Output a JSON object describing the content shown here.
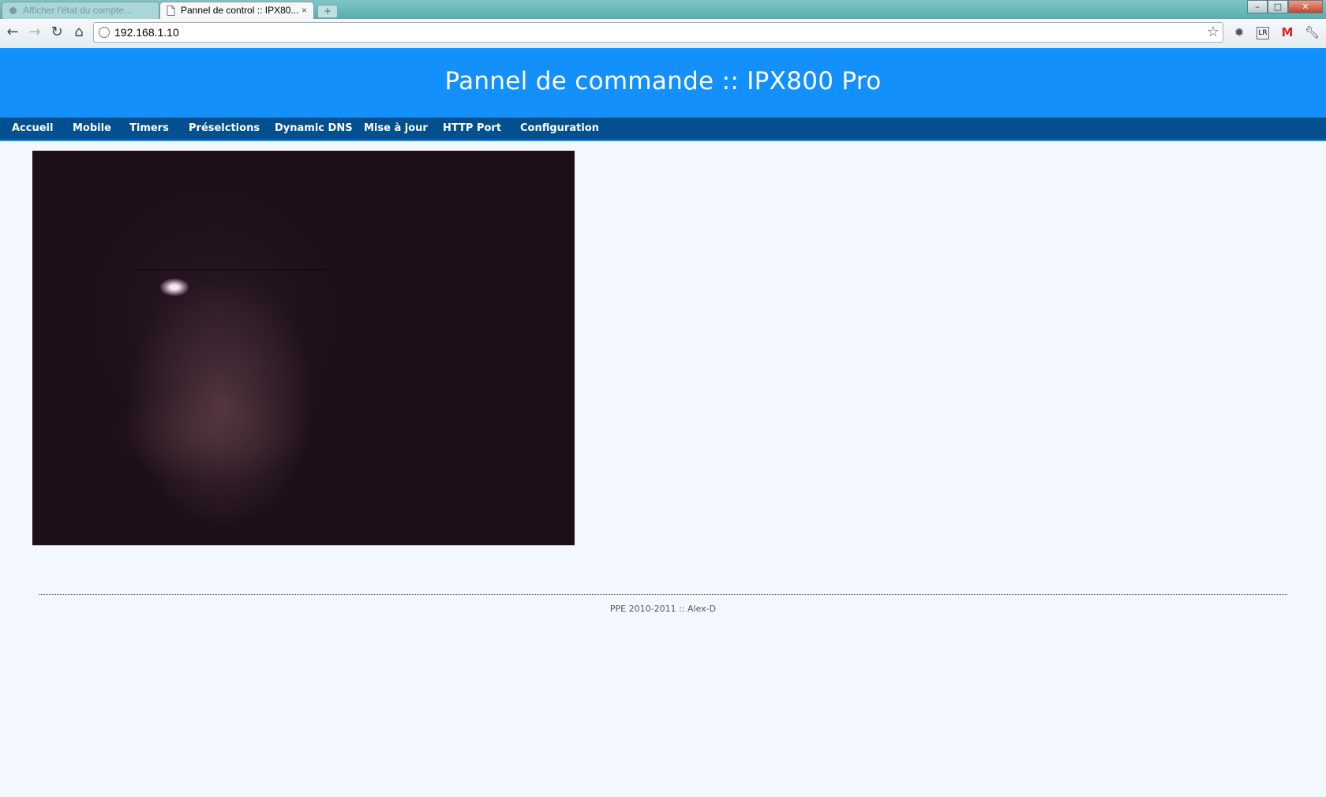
{
  "browser": {
    "tabs": [
      {
        "title": "Afficher l'état du compte..."
      },
      {
        "title": "Pannel de control :: IPX80..."
      }
    ],
    "new_tab_label": "+",
    "url": "192.168.1.10",
    "window_buttons": {
      "minimize": "–",
      "maximize": "□",
      "close": "✕"
    },
    "extensions": [
      "gear-extension-icon",
      "lr-extension-icon",
      "gmail-icon",
      "wrench-icon"
    ]
  },
  "header": {
    "title": "Pannel de commande :: IPX800 Pro",
    "color": "#1390fb"
  },
  "menu": {
    "color": "#02508f",
    "items": [
      {
        "label": "Accueil"
      },
      {
        "label": "Mobile"
      },
      {
        "label": "Timers"
      },
      {
        "label": "Préselctions"
      },
      {
        "label": "Dynamic DNS"
      },
      {
        "label": "Mise à jour"
      },
      {
        "label": "HTTP Port"
      },
      {
        "label": "Configuration"
      }
    ]
  },
  "main": {
    "image": "webcam-feed"
  },
  "footer": {
    "text": "PPE 2010-2011 :: Alex-D"
  }
}
